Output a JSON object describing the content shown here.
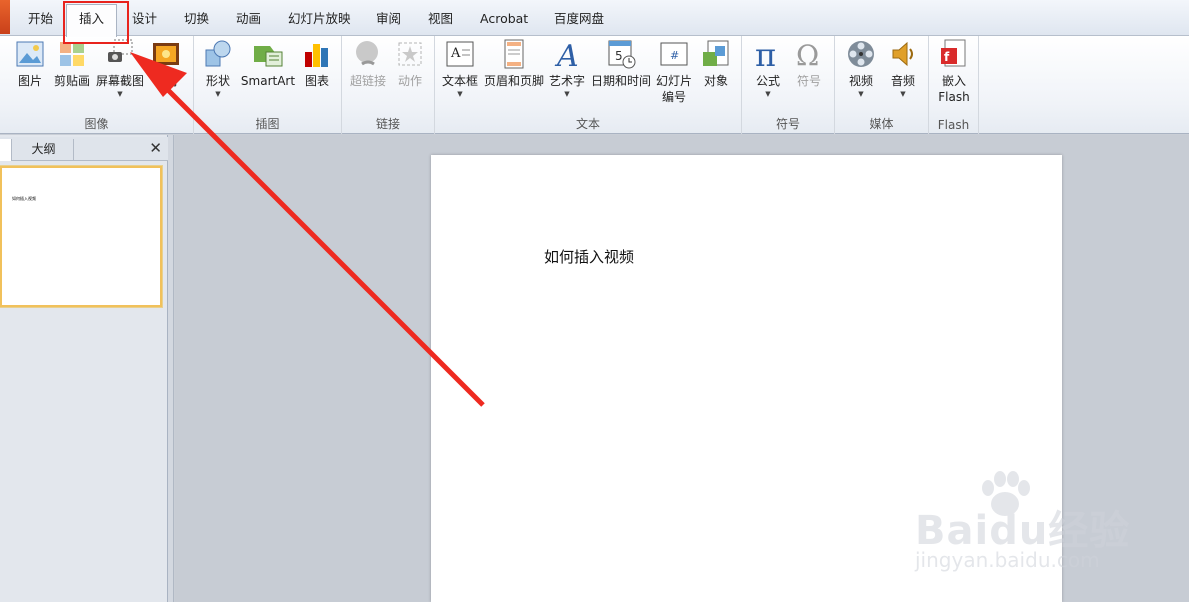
{
  "tabs": [
    {
      "label": "开始"
    },
    {
      "label": "插入"
    },
    {
      "label": "设计"
    },
    {
      "label": "切换"
    },
    {
      "label": "动画"
    },
    {
      "label": "幻灯片放映"
    },
    {
      "label": "审阅"
    },
    {
      "label": "视图"
    },
    {
      "label": "Acrobat"
    },
    {
      "label": "百度网盘"
    }
  ],
  "active_tab": "插入",
  "ribbon": {
    "images": {
      "label": "图像",
      "picture": "图片",
      "clipart": "剪贴画",
      "screenshot": "屏幕截图",
      "album": "相册"
    },
    "illustrations": {
      "label": "插图",
      "shapes": "形状",
      "smartart": "SmartArt",
      "chart": "图表"
    },
    "links": {
      "label": "链接",
      "hyperlink": "超链接",
      "action": "动作"
    },
    "text": {
      "label": "文本",
      "textbox": "文本框",
      "header_footer": "页眉和页脚",
      "wordart": "艺术字",
      "datetime": "日期和时间",
      "slide_number_line1": "幻灯片",
      "slide_number_line2": "编号",
      "object": "对象"
    },
    "symbols": {
      "label": "符号",
      "equation": "公式",
      "symbol": "符号"
    },
    "media": {
      "label": "媒体",
      "video": "视频",
      "audio": "音频"
    },
    "flash": {
      "label": "Flash",
      "embed_line1": "嵌入",
      "embed_line2": "Flash"
    }
  },
  "left_panel": {
    "outline_tab": "大纲",
    "close_glyph": "✕",
    "thumb_text": "如何插入视频"
  },
  "slide": {
    "text": "如何插入视频"
  },
  "watermark": {
    "brand": "Baidu经验",
    "url": "jingyan.baidu.com"
  },
  "colors": {
    "annotation": "#e8231d",
    "accent_file": "#d9502a"
  }
}
